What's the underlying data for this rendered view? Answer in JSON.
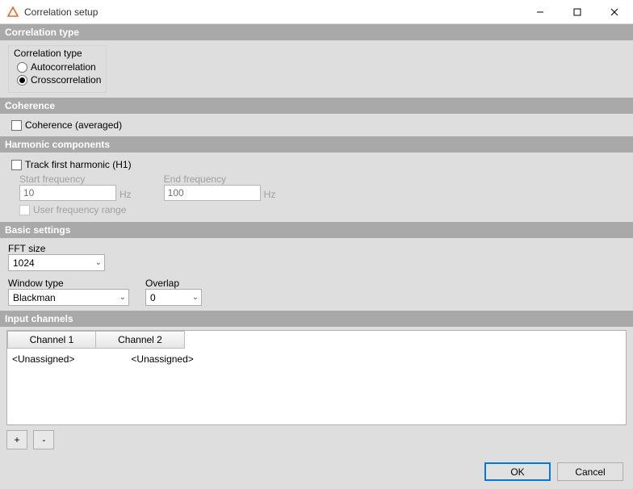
{
  "window": {
    "title": "Correlation setup"
  },
  "sections": {
    "correlation_type": {
      "header": "Correlation type",
      "label": "Correlation type",
      "options": {
        "auto": "Autocorrelation",
        "cross": "Crosscorrelation"
      },
      "selected": "cross"
    },
    "coherence": {
      "header": "Coherence",
      "checkbox_label": "Coherence (averaged)",
      "checked": false
    },
    "harmonic": {
      "header": "Harmonic components",
      "track_label": "Track first harmonic (H1)",
      "track_checked": false,
      "start_label": "Start frequency",
      "start_value": "10",
      "end_label": "End frequency",
      "end_value": "100",
      "unit": "Hz",
      "user_range_label": "User frequency range",
      "user_range_checked": false
    },
    "basic": {
      "header": "Basic settings",
      "fft_label": "FFT size",
      "fft_value": "1024",
      "window_label": "Window type",
      "window_value": "Blackman",
      "overlap_label": "Overlap",
      "overlap_value": "0"
    },
    "input_channels": {
      "header": "Input channels",
      "tabs": [
        "Channel 1",
        "Channel 2"
      ],
      "values": [
        "<Unassigned>",
        "<Unassigned>"
      ],
      "add": "+",
      "remove": "-"
    }
  },
  "footer": {
    "ok": "OK",
    "cancel": "Cancel"
  }
}
